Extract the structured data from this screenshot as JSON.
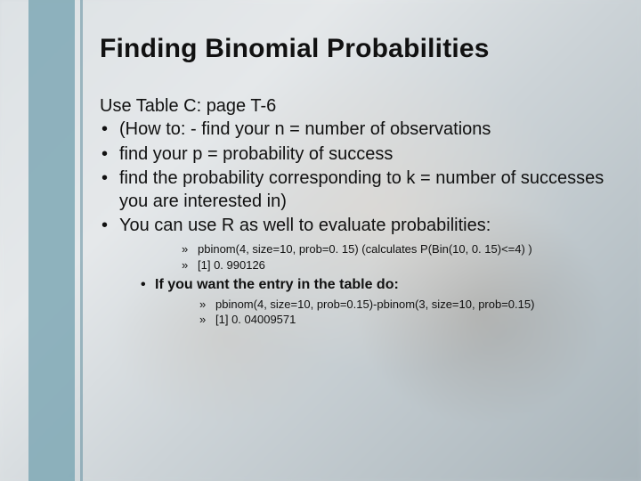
{
  "title": "Finding Binomial Probabilities",
  "intro": "Use Table C: page T-6",
  "bullets": [
    "(How to: -    find your n = number of observations",
    "find your p = probability of success",
    "find the probability corresponding to k = number of successes you are interested in)",
    "You can use R as well to evaluate probabilities:"
  ],
  "sub1": [
    "pbinom(4, size=10, prob=0. 15) (calculates P(Bin(10, 0. 15)<=4) )",
    "[1] 0. 990126"
  ],
  "nested_bullet": "If you want the entry in the table do:",
  "sub2": [
    "pbinom(4, size=10, prob=0.15)-pbinom(3, size=10, prob=0.15)",
    "[1] 0. 04009571"
  ]
}
